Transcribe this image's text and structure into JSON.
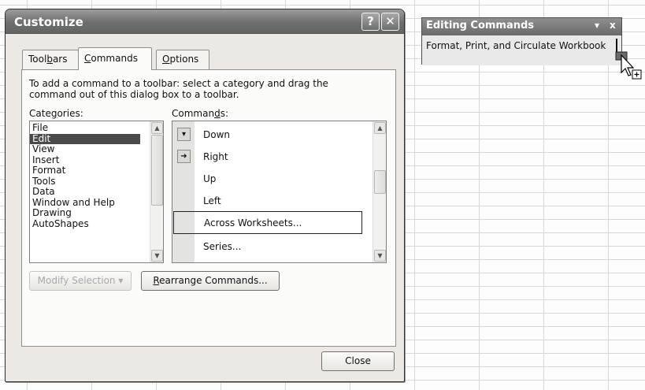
{
  "dialog": {
    "title": "Customize",
    "help_glyph": "?",
    "close_glyph": "✕",
    "tabs": [
      {
        "pre": "Tool",
        "key": "b",
        "post": "ars"
      },
      {
        "pre": "",
        "key": "C",
        "post": "ommands"
      },
      {
        "pre": "",
        "key": "O",
        "post": "ptions"
      }
    ],
    "instruction": "To add a command to a toolbar: select a category and drag the command out of this dialog box to a toolbar.",
    "categories_label": {
      "pre": "Cate",
      "key": "g",
      "post": "ories:"
    },
    "commands_label": {
      "pre": "Comman",
      "key": "d",
      "post": "s:"
    },
    "categories": [
      "File",
      "Edit",
      "View",
      "Insert",
      "Format",
      "Tools",
      "Data",
      "Window and Help",
      "Drawing",
      "AutoShapes"
    ],
    "selected_category": "Edit",
    "commands": [
      {
        "label": "Down",
        "icon": "arrow-down-icon"
      },
      {
        "label": "Right",
        "icon": "arrow-right-icon"
      },
      {
        "label": "Up",
        "icon": "none"
      },
      {
        "label": "Left",
        "icon": "none"
      },
      {
        "label": "Across Worksheets...",
        "icon": "none"
      },
      {
        "label": "Series...",
        "icon": "none"
      }
    ],
    "selected_command": "Across Worksheets...",
    "modify_selection": "Modify Selection ▾",
    "rearrange": {
      "pre": "",
      "key": "R",
      "post": "earrange Commands..."
    },
    "close_button": "Close"
  },
  "toolbar": {
    "title": "Editing Commands",
    "menu_glyph": "▾",
    "close_glyph": "x",
    "content": "Format, Print, and Circulate Workbook"
  },
  "colors": {
    "title_bar": "#6e6e6e",
    "dialog_bg": "#ece9e4",
    "selection": "#4a4a4a"
  }
}
